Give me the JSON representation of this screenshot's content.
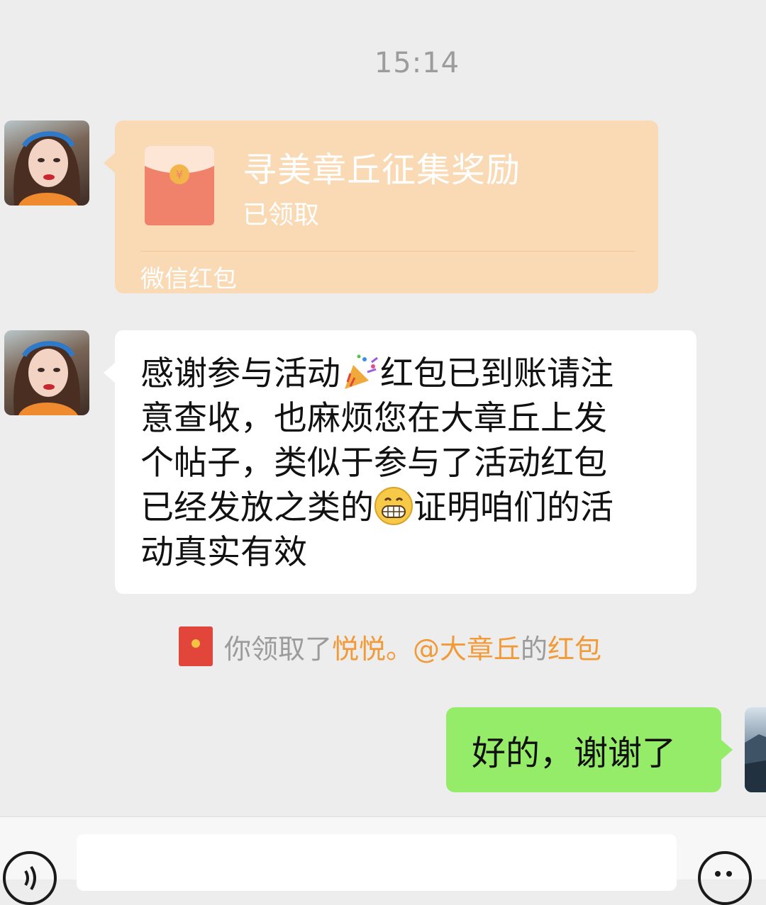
{
  "chat": {
    "timestamp": "15:14",
    "red_packet": {
      "title": "寻美章丘征集奖励",
      "status": "已领取",
      "footer": "微信红包"
    },
    "message_lines": [
      "感谢参与活动",
      "红包已到账请注",
      "意查收，也麻烦您在大章丘上发",
      "个帖子，类似于参与了活动红包",
      "已经发放之类的",
      "证明咱们的活",
      "动真实有效"
    ],
    "system_notice": {
      "prefix": "你领取了",
      "sender": "悦悦。@大章丘",
      "middle": "的",
      "link": "红包"
    },
    "outgoing_message": "好的，谢谢了"
  },
  "input_bar": {
    "placeholder": ""
  },
  "colors": {
    "red_packet_bg": "#fad9b5",
    "outgoing_bubble": "#95ec69",
    "notice_orange": "#f29a38"
  },
  "icons": {
    "party_popper": "party-popper-icon",
    "grin": "grinning-face-icon",
    "voice": "voice-icon",
    "emoji": "emoji-icon"
  }
}
